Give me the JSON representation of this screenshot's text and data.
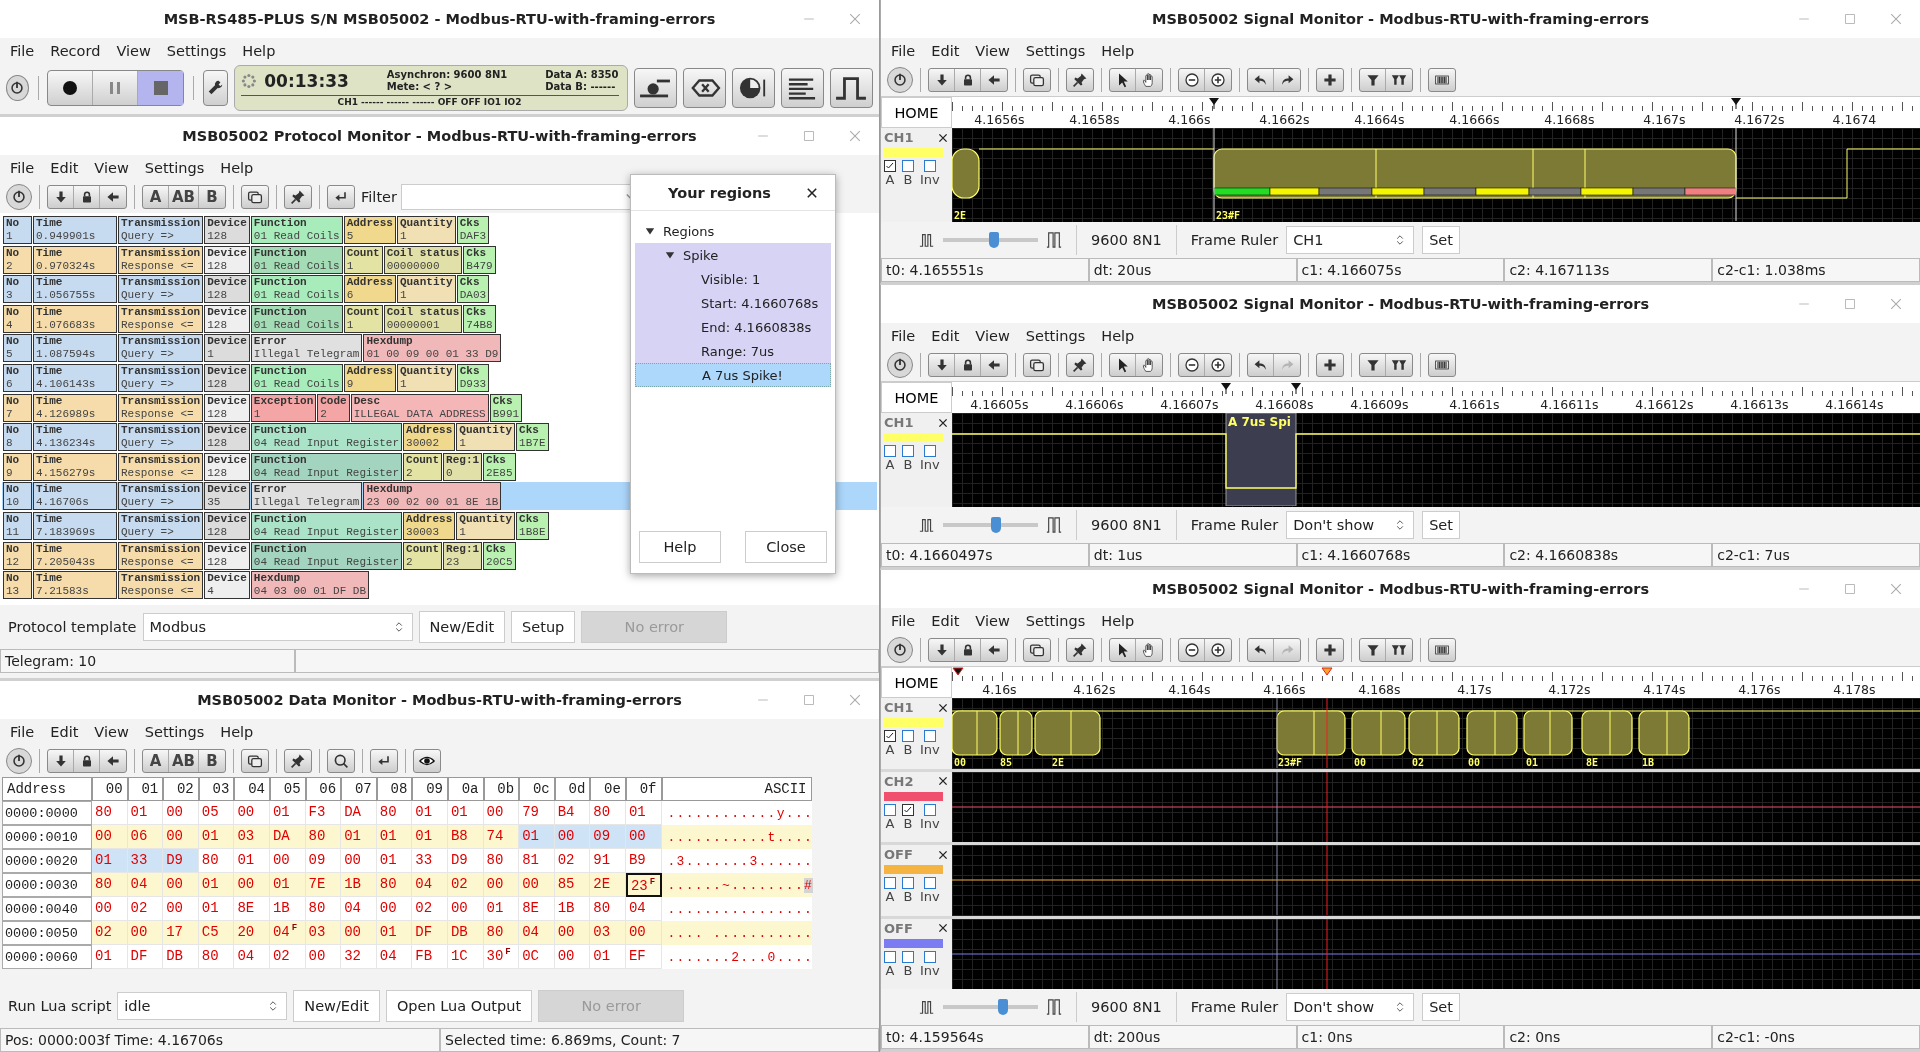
{
  "main_window": {
    "title": "MSB-RS485-PLUS S/N MSB05002 - Modbus-RTU-with-framing-errors",
    "menu": [
      "File",
      "Record",
      "View",
      "Settings",
      "Help"
    ],
    "transport": [
      {
        "kind": "record",
        "selected": false
      },
      {
        "kind": "pause",
        "selected": false
      },
      {
        "kind": "stop",
        "selected": true
      }
    ],
    "status_panel": {
      "elapsed": "00:13:33",
      "mode": "Asynchron: 9600 8N1",
      "mete": "Mete: < ? >",
      "data_a": "Data A: 8350",
      "data_b": "Data B: ------",
      "channels": "CH1 ------ ------ ------ OFF OFF IO1 IO2"
    }
  },
  "protocol_monitor": {
    "title": "MSB05002 Protocol Monitor - Modbus-RTU-with-framing-errors",
    "menu": [
      "File",
      "Edit",
      "View",
      "Settings",
      "Help"
    ],
    "view_buttons": [
      "A",
      "AB",
      "B"
    ],
    "filter_label": "Filter",
    "rows": [
      {
        "selected": false,
        "fields": [
          {
            "label": "No",
            "value": "1",
            "color": "#c6daf0"
          },
          {
            "label": "Time",
            "value": "0.949901s",
            "color": "#c6daf0"
          },
          {
            "label": "Transmission",
            "value": "Query =>",
            "color": "#c6daf0"
          },
          {
            "label": "Device",
            "value": "128",
            "color": "#dcdcdc"
          },
          {
            "label": "Function",
            "value": "01 Read Coils",
            "color": "#a9ecbc"
          },
          {
            "label": "Address",
            "value": "5",
            "color": "#f0d98c"
          },
          {
            "label": "Quantity",
            "value": "1",
            "color": "#f0e0b4"
          },
          {
            "label": "Cks",
            "value": "DAF3",
            "color": "#b9f2b0"
          }
        ]
      },
      {
        "selected": false,
        "fields": [
          {
            "label": "No",
            "value": "2",
            "color": "#f5dcaa"
          },
          {
            "label": "Time",
            "value": "0.970324s",
            "color": "#f5dcaa"
          },
          {
            "label": "Transmission",
            "value": "Response <=",
            "color": "#f5dcaa"
          },
          {
            "label": "Device",
            "value": "128",
            "color": "#efefef"
          },
          {
            "label": "Function",
            "value": "01 Read Coils",
            "color": "#a3dcb5"
          },
          {
            "label": "Count",
            "value": "1",
            "color": "#e3e3a3"
          },
          {
            "label": "Coil status",
            "value": "00000000",
            "color": "#e1e0a8"
          },
          {
            "label": "Cks",
            "value": "B479",
            "color": "#b9f2b0"
          }
        ]
      },
      {
        "selected": false,
        "fields": [
          {
            "label": "No",
            "value": "3",
            "color": "#c6daf0"
          },
          {
            "label": "Time",
            "value": "1.056755s",
            "color": "#c6daf0"
          },
          {
            "label": "Transmission",
            "value": "Query =>",
            "color": "#c6daf0"
          },
          {
            "label": "Device",
            "value": "128",
            "color": "#dcdcdc"
          },
          {
            "label": "Function",
            "value": "01 Read Coils",
            "color": "#a9ecbc"
          },
          {
            "label": "Address",
            "value": "6",
            "color": "#f0d98c"
          },
          {
            "label": "Quantity",
            "value": "1",
            "color": "#f0e0b4"
          },
          {
            "label": "Cks",
            "value": "DA03",
            "color": "#b9f2b0"
          }
        ]
      },
      {
        "selected": false,
        "fields": [
          {
            "label": "No",
            "value": "4",
            "color": "#f5dcaa"
          },
          {
            "label": "Time",
            "value": "1.076683s",
            "color": "#f5dcaa"
          },
          {
            "label": "Transmission",
            "value": "Response <=",
            "color": "#f5dcaa"
          },
          {
            "label": "Device",
            "value": "128",
            "color": "#efefef"
          },
          {
            "label": "Function",
            "value": "01 Read Coils",
            "color": "#a3dcb5"
          },
          {
            "label": "Count",
            "value": "1",
            "color": "#e3e3a3"
          },
          {
            "label": "Coil status",
            "value": "00000001",
            "color": "#e1e0a8"
          },
          {
            "label": "Cks",
            "value": "74B8",
            "color": "#b9f2b0"
          }
        ]
      },
      {
        "selected": false,
        "fields": [
          {
            "label": "No",
            "value": "5",
            "color": "#c6daf0"
          },
          {
            "label": "Time",
            "value": "1.087594s",
            "color": "#c6daf0"
          },
          {
            "label": "Transmission",
            "value": "Query =>",
            "color": "#c6daf0"
          },
          {
            "label": "Device",
            "value": "1",
            "color": "#dcdcdc"
          },
          {
            "label": "Error",
            "value": "Illegal Telegram",
            "color": "#e0e0e0"
          },
          {
            "label": "Hexdump",
            "value": "01 00 09 00 01 33 D9",
            "color": "#f0b8b8"
          }
        ]
      },
      {
        "selected": false,
        "fields": [
          {
            "label": "No",
            "value": "6",
            "color": "#c6daf0"
          },
          {
            "label": "Time",
            "value": "4.106143s",
            "color": "#c6daf0"
          },
          {
            "label": "Transmission",
            "value": "Query =>",
            "color": "#c6daf0"
          },
          {
            "label": "Device",
            "value": "128",
            "color": "#dcdcdc"
          },
          {
            "label": "Function",
            "value": "01 Read Coils",
            "color": "#a9ecbc"
          },
          {
            "label": "Address",
            "value": "9",
            "color": "#f0d98c"
          },
          {
            "label": "Quantity",
            "value": "1",
            "color": "#f0e0b4"
          },
          {
            "label": "Cks",
            "value": "D933",
            "color": "#b9f2b0"
          }
        ]
      },
      {
        "selected": false,
        "fields": [
          {
            "label": "No",
            "value": "7",
            "color": "#f5dcaa"
          },
          {
            "label": "Time",
            "value": "4.126989s",
            "color": "#f5dcaa"
          },
          {
            "label": "Transmission",
            "value": "Response <=",
            "color": "#f5dcaa"
          },
          {
            "label": "Device",
            "value": "128",
            "color": "#efefef"
          },
          {
            "label": "Exception",
            "value": "1",
            "color": "#f4a6a6"
          },
          {
            "label": "Code",
            "value": "2",
            "color": "#f4a6a6"
          },
          {
            "label": "Desc",
            "value": "ILLEGAL DATA ADDRESS",
            "color": "#f4b6b6"
          },
          {
            "label": "Cks",
            "value": "B991",
            "color": "#b9f2b0"
          }
        ]
      },
      {
        "selected": false,
        "fields": [
          {
            "label": "No",
            "value": "8",
            "color": "#c6daf0"
          },
          {
            "label": "Time",
            "value": "4.136234s",
            "color": "#c6daf0"
          },
          {
            "label": "Transmission",
            "value": "Query =>",
            "color": "#c6daf0"
          },
          {
            "label": "Device",
            "value": "128",
            "color": "#dcdcdc"
          },
          {
            "label": "Function",
            "value": "04 Read Input Register",
            "color": "#abe3c8"
          },
          {
            "label": "Address",
            "value": "30002",
            "color": "#f0d98c"
          },
          {
            "label": "Quantity",
            "value": "1",
            "color": "#f0e0b4"
          },
          {
            "label": "Cks",
            "value": "1B7E",
            "color": "#b9f2b0"
          }
        ]
      },
      {
        "selected": false,
        "fields": [
          {
            "label": "No",
            "value": "9",
            "color": "#f5dcaa"
          },
          {
            "label": "Time",
            "value": "4.156279s",
            "color": "#f5dcaa"
          },
          {
            "label": "Transmission",
            "value": "Response <=",
            "color": "#f5dcaa"
          },
          {
            "label": "Device",
            "value": "128",
            "color": "#efefef"
          },
          {
            "label": "Function",
            "value": "04 Read Input Register",
            "color": "#a3d4bf"
          },
          {
            "label": "Count",
            "value": "2",
            "color": "#e3e3a3"
          },
          {
            "label": "Reg:1",
            "value": "0",
            "color": "#e1e0a8"
          },
          {
            "label": "Cks",
            "value": "2E85",
            "color": "#b9f2b0"
          }
        ]
      },
      {
        "selected": true,
        "fields": [
          {
            "label": "No",
            "value": "10",
            "color": "#c6daf0"
          },
          {
            "label": "Time",
            "value": "4.16706s",
            "color": "#c6daf0"
          },
          {
            "label": "Transmission",
            "value": "Query =>",
            "color": "#c6daf0"
          },
          {
            "label": "Device",
            "value": "35",
            "color": "#dcdcdc"
          },
          {
            "label": "Error",
            "value": "Illegal Telegram",
            "color": "#e0e0e0"
          },
          {
            "label": "Hexdump",
            "value": "23 00 02 00 01 8E 1B",
            "color": "#f0b8b8"
          }
        ]
      },
      {
        "selected": false,
        "fields": [
          {
            "label": "No",
            "value": "11",
            "color": "#c6daf0"
          },
          {
            "label": "Time",
            "value": "7.183969s",
            "color": "#c6daf0"
          },
          {
            "label": "Transmission",
            "value": "Query =>",
            "color": "#c6daf0"
          },
          {
            "label": "Device",
            "value": "128",
            "color": "#dcdcdc"
          },
          {
            "label": "Function",
            "value": "04 Read Input Register",
            "color": "#abe3c8"
          },
          {
            "label": "Address",
            "value": "30003",
            "color": "#f0d98c"
          },
          {
            "label": "Quantity",
            "value": "1",
            "color": "#f0e0b4"
          },
          {
            "label": "Cks",
            "value": "1B8E",
            "color": "#b9f2b0"
          }
        ]
      },
      {
        "selected": false,
        "fields": [
          {
            "label": "No",
            "value": "12",
            "color": "#f5dcaa"
          },
          {
            "label": "Time",
            "value": "7.205043s",
            "color": "#f5dcaa"
          },
          {
            "label": "Transmission",
            "value": "Response <=",
            "color": "#f5dcaa"
          },
          {
            "label": "Device",
            "value": "128",
            "color": "#efefef"
          },
          {
            "label": "Function",
            "value": "04 Read Input Register",
            "color": "#a3d4bf"
          },
          {
            "label": "Count",
            "value": "2",
            "color": "#e3e3a3"
          },
          {
            "label": "Reg:1",
            "value": "23",
            "color": "#e1e0a8"
          },
          {
            "label": "Cks",
            "value": "20C5",
            "color": "#b9f2b0"
          }
        ]
      },
      {
        "selected": false,
        "fields": [
          {
            "label": "No",
            "value": "13",
            "color": "#f5dcaa"
          },
          {
            "label": "Time",
            "value": "7.21583s",
            "color": "#f5dcaa"
          },
          {
            "label": "Transmission",
            "value": "Response <=",
            "color": "#f5dcaa"
          },
          {
            "label": "Device",
            "value": "4",
            "color": "#efefef"
          },
          {
            "label": "Hexdump",
            "value": "04 03 00 01 DF DB",
            "color": "#f0b8b8"
          }
        ]
      }
    ],
    "template_label": "Protocol template",
    "template": "Modbus",
    "buttons": [
      {
        "label": "New/Edit",
        "disabled": false
      },
      {
        "label": "Setup",
        "disabled": false
      },
      {
        "label": "No error",
        "disabled": true
      }
    ],
    "status": "Telegram: 10"
  },
  "regions_dialog": {
    "title": "Your regions",
    "tree": [
      {
        "label": "Regions",
        "expanded": true,
        "selected": false,
        "children": [
          {
            "label": "Spike",
            "expanded": true,
            "selected": false,
            "color": "#d7d3f4",
            "children": [
              {
                "label": "Visible: 1",
                "selected": false
              },
              {
                "label": "Start: 4.1660768s",
                "selected": false
              },
              {
                "label": "End: 4.1660838s",
                "selected": false
              },
              {
                "label": "Range: 7us",
                "selected": false
              },
              {
                "label": "A 7us Spike!",
                "selected": true
              }
            ]
          }
        ]
      }
    ],
    "buttons": [
      "Help",
      "Close"
    ]
  },
  "data_monitor": {
    "title": "MSB05002 Data Monitor - Modbus-RTU-with-framing-errors",
    "menu": [
      "File",
      "Edit",
      "View",
      "Settings",
      "Help"
    ],
    "view_buttons": [
      "A",
      "AB",
      "B"
    ],
    "columns": [
      "Address",
      "00",
      "01",
      "02",
      "03",
      "04",
      "05",
      "06",
      "07",
      "08",
      "09",
      "0a",
      "0b",
      "0c",
      "0d",
      "0e",
      "0f",
      "ASCII"
    ],
    "rows": [
      {
        "address": "0000:0000",
        "ascii": "............y...",
        "cells": [
          {
            "value": "80",
            "selected": false,
            "focused": false
          },
          {
            "value": "01",
            "selected": false,
            "focused": false
          },
          {
            "value": "00",
            "selected": false,
            "focused": false
          },
          {
            "value": "05",
            "selected": false,
            "focused": false
          },
          {
            "value": "00",
            "selected": false,
            "focused": false
          },
          {
            "value": "01",
            "selected": false,
            "focused": false
          },
          {
            "value": "F3",
            "selected": false,
            "focused": false
          },
          {
            "value": "DA",
            "selected": false,
            "focused": false
          },
          {
            "value": "80",
            "selected": false,
            "focused": false
          },
          {
            "value": "01",
            "selected": false,
            "focused": false
          },
          {
            "value": "01",
            "selected": false,
            "focused": false
          },
          {
            "value": "00",
            "selected": false,
            "focused": false
          },
          {
            "value": "79",
            "selected": false,
            "focused": false
          },
          {
            "value": "B4",
            "selected": false,
            "focused": false
          },
          {
            "value": "80",
            "selected": false,
            "focused": false
          },
          {
            "value": "01",
            "selected": false,
            "focused": false
          }
        ]
      },
      {
        "address": "0000:0010",
        "ascii": "...........t....",
        "cells": [
          {
            "value": "00",
            "selected": false,
            "focused": false
          },
          {
            "value": "06",
            "selected": false,
            "focused": false
          },
          {
            "value": "00",
            "selected": false,
            "focused": false
          },
          {
            "value": "01",
            "selected": false,
            "focused": false
          },
          {
            "value": "03",
            "selected": false,
            "focused": false
          },
          {
            "value": "DA",
            "selected": false,
            "focused": false
          },
          {
            "value": "80",
            "selected": false,
            "focused": false
          },
          {
            "value": "01",
            "selected": false,
            "focused": false
          },
          {
            "value": "01",
            "selected": false,
            "focused": false
          },
          {
            "value": "01",
            "selected": false,
            "focused": false
          },
          {
            "value": "B8",
            "selected": false,
            "focused": false
          },
          {
            "value": "74",
            "selected": false,
            "focused": false
          },
          {
            "value": "01",
            "selected": true,
            "focused": false
          },
          {
            "value": "00",
            "selected": true,
            "focused": false
          },
          {
            "value": "09",
            "selected": true,
            "focused": false
          },
          {
            "value": "00",
            "selected": true,
            "focused": false
          }
        ]
      },
      {
        "address": "0000:0020",
        "ascii": ".3.......3......",
        "cells": [
          {
            "value": "01",
            "selected": true,
            "focused": false
          },
          {
            "value": "33",
            "selected": true,
            "focused": false
          },
          {
            "value": "D9",
            "selected": true,
            "focused": false
          },
          {
            "value": "80",
            "selected": false,
            "focused": false
          },
          {
            "value": "01",
            "selected": false,
            "focused": false
          },
          {
            "value": "00",
            "selected": false,
            "focused": false
          },
          {
            "value": "09",
            "selected": false,
            "focused": false
          },
          {
            "value": "00",
            "selected": false,
            "focused": false
          },
          {
            "value": "01",
            "selected": false,
            "focused": false
          },
          {
            "value": "33",
            "selected": false,
            "focused": false
          },
          {
            "value": "D9",
            "selected": false,
            "focused": false
          },
          {
            "value": "80",
            "selected": false,
            "focused": false
          },
          {
            "value": "81",
            "selected": false,
            "focused": false
          },
          {
            "value": "02",
            "selected": false,
            "focused": false
          },
          {
            "value": "91",
            "selected": false,
            "focused": false
          },
          {
            "value": "B9",
            "selected": false,
            "focused": false
          }
        ]
      },
      {
        "address": "0000:0030",
        "ascii": "......~........#",
        "cells": [
          {
            "value": "80",
            "selected": false,
            "focused": false
          },
          {
            "value": "04",
            "selected": false,
            "focused": false
          },
          {
            "value": "00",
            "selected": false,
            "focused": false
          },
          {
            "value": "01",
            "selected": false,
            "focused": false
          },
          {
            "value": "00",
            "selected": false,
            "focused": false
          },
          {
            "value": "01",
            "selected": false,
            "focused": false
          },
          {
            "value": "7E",
            "selected": false,
            "focused": false
          },
          {
            "value": "1B",
            "selected": false,
            "focused": false
          },
          {
            "value": "80",
            "selected": false,
            "focused": false
          },
          {
            "value": "04",
            "selected": false,
            "focused": false
          },
          {
            "value": "02",
            "selected": false,
            "focused": false
          },
          {
            "value": "00",
            "selected": false,
            "focused": false
          },
          {
            "value": "00",
            "selected": false,
            "focused": false
          },
          {
            "value": "85",
            "selected": false,
            "focused": false
          },
          {
            "value": "2E",
            "selected": false,
            "focused": false
          },
          {
            "value": "23$^{F}$",
            "selected": false,
            "focused": true
          }
        ]
      },
      {
        "address": "0000:0040",
        "ascii": "................",
        "cells": [
          {
            "value": "00",
            "selected": false,
            "focused": false
          },
          {
            "value": "02",
            "selected": false,
            "focused": false
          },
          {
            "value": "00",
            "selected": false,
            "focused": false
          },
          {
            "value": "01",
            "selected": false,
            "focused": false
          },
          {
            "value": "8E",
            "selected": false,
            "focused": false
          },
          {
            "value": "1B",
            "selected": false,
            "focused": false
          },
          {
            "value": "80",
            "selected": false,
            "focused": false
          },
          {
            "value": "04",
            "selected": false,
            "focused": false
          },
          {
            "value": "00",
            "selected": false,
            "focused": false
          },
          {
            "value": "02",
            "selected": false,
            "focused": false
          },
          {
            "value": "00",
            "selected": false,
            "focused": false
          },
          {
            "value": "01",
            "selected": false,
            "focused": false
          },
          {
            "value": "8E",
            "selected": false,
            "focused": false
          },
          {
            "value": "1B",
            "selected": false,
            "focused": false
          },
          {
            "value": "80",
            "selected": false,
            "focused": false
          },
          {
            "value": "04",
            "selected": false,
            "focused": false
          }
        ]
      },
      {
        "address": "0000:0050",
        "ascii": ".... ...........",
        "cells": [
          {
            "value": "02",
            "selected": false,
            "focused": false
          },
          {
            "value": "00",
            "selected": false,
            "focused": false
          },
          {
            "value": "17",
            "selected": false,
            "focused": false
          },
          {
            "value": "C5",
            "selected": false,
            "focused": false
          },
          {
            "value": "20",
            "selected": false,
            "focused": false
          },
          {
            "value": "04$^{F}$",
            "selected": false,
            "focused": false
          },
          {
            "value": "03",
            "selected": false,
            "focused": false
          },
          {
            "value": "00",
            "selected": false,
            "focused": false
          },
          {
            "value": "01",
            "selected": false,
            "focused": false
          },
          {
            "value": "DF",
            "selected": false,
            "focused": false
          },
          {
            "value": "DB",
            "selected": false,
            "focused": false
          },
          {
            "value": "80",
            "selected": false,
            "focused": false
          },
          {
            "value": "04",
            "selected": false,
            "focused": false
          },
          {
            "value": "00",
            "selected": false,
            "focused": false
          },
          {
            "value": "03",
            "selected": false,
            "focused": false
          },
          {
            "value": "00",
            "selected": false,
            "focused": false
          }
        ]
      },
      {
        "address": "0000:0060",
        "ascii": ".......2...0....",
        "cells": [
          {
            "value": "01",
            "selected": false,
            "focused": false
          },
          {
            "value": "DF",
            "selected": false,
            "focused": false
          },
          {
            "value": "DB",
            "selected": false,
            "focused": false
          },
          {
            "value": "80",
            "selected": false,
            "focused": false
          },
          {
            "value": "04",
            "selected": false,
            "focused": false
          },
          {
            "value": "02",
            "selected": false,
            "focused": false
          },
          {
            "value": "00",
            "selected": false,
            "focused": false
          },
          {
            "value": "32",
            "selected": false,
            "focused": false
          },
          {
            "value": "04",
            "selected": false,
            "focused": false
          },
          {
            "value": "FB",
            "selected": false,
            "focused": false
          },
          {
            "value": "1C",
            "selected": false,
            "focused": false
          },
          {
            "value": "30$^{F}$",
            "selected": false,
            "focused": false
          },
          {
            "value": "0C",
            "selected": false,
            "focused": false
          },
          {
            "value": "00",
            "selected": false,
            "focused": false
          },
          {
            "value": "01",
            "selected": false,
            "focused": false
          },
          {
            "value": "EF",
            "selected": false,
            "focused": false
          }
        ]
      }
    ],
    "script_label": "Run Lua script",
    "script": "idle",
    "buttons": [
      {
        "label": "New/Edit",
        "disabled": false
      },
      {
        "label": "Open Lua Output",
        "disabled": false
      },
      {
        "label": "No error",
        "disabled": true
      }
    ],
    "status": [
      "Pos: 0000:003f Time: 4.16706s",
      "Selected time: 6.869ms, Count: 7"
    ]
  },
  "signal_monitors": [
    {
      "title": "MSB05002 Signal Monitor - Modbus-RTU-with-framing-errors",
      "menu": [
        "File",
        "Edit",
        "View",
        "Settings",
        "Help"
      ],
      "redo_disabled": false,
      "home": "HOME",
      "kind": "detail",
      "ticks": [
        "4.1656s",
        "4.1658s",
        "4.166s",
        "4.1662s",
        "4.1664s",
        "4.1666s",
        "4.1668s",
        "4.167s",
        "4.1672s",
        "4.1674"
      ],
      "channels": [
        {
          "name": "CH1",
          "color": "#ffff66",
          "checks": [
            {
              "label": "A",
              "checked": true
            },
            {
              "label": "B",
              "checked": false
            },
            {
              "label": "Inv",
              "checked": false
            }
          ],
          "frames": [
            "2E",
            "23#F"
          ]
        }
      ],
      "slider": {
        "level": 0.54
      },
      "baud": "9600 8N1",
      "ruler_label": "Frame Ruler",
      "ruler": "CH1",
      "set": "Set",
      "status": [
        "t0: 4.165551s",
        "dt: 20us",
        "c1: 4.166075s",
        "c2: 4.167113s",
        "c2-c1: 1.038ms"
      ]
    },
    {
      "title": "MSB05002 Signal Monitor - Modbus-RTU-with-framing-errors",
      "menu": [
        "File",
        "Edit",
        "View",
        "Settings",
        "Help"
      ],
      "redo_disabled": true,
      "home": "HOME",
      "kind": "spike",
      "region_label": "A 7us Spi",
      "ticks": [
        "4.16605s",
        "4.16606s",
        "4.16607s",
        "4.16608s",
        "4.16609s",
        "4.1661s",
        "4.16611s",
        "4.16612s",
        "4.16613s",
        "4.16614s"
      ],
      "channels": [
        {
          "name": "CH1",
          "color": "#ffff66",
          "checks": [
            {
              "label": "A",
              "checked": false
            },
            {
              "label": "B",
              "checked": false
            },
            {
              "label": "Inv",
              "checked": false
            }
          ]
        }
      ],
      "slider": {
        "level": 0.56
      },
      "baud": "9600 8N1",
      "ruler_label": "Frame Ruler",
      "ruler": "Don't show",
      "set": "Set",
      "status": [
        "t0: 4.1660497s",
        "dt: 1us",
        "c1: 4.1660768s",
        "c2: 4.1660838s",
        "c2-c1: 7us"
      ]
    },
    {
      "title": "MSB05002 Signal Monitor - Modbus-RTU-with-framing-errors",
      "menu": [
        "File",
        "Edit",
        "View",
        "Settings",
        "Help"
      ],
      "redo_disabled": true,
      "home": "HOME",
      "kind": "overview",
      "ticks": [
        "4.16s",
        "4.162s",
        "4.164s",
        "4.166s",
        "4.168s",
        "4.17s",
        "4.172s",
        "4.174s",
        "4.176s",
        "4.178s"
      ],
      "channels": [
        {
          "name": "CH1",
          "color": "#ffff66",
          "checks": [
            {
              "label": "A",
              "checked": true
            },
            {
              "label": "B",
              "checked": false
            },
            {
              "label": "Inv",
              "checked": false
            }
          ],
          "frames": [
            "00",
            "85",
            "2E",
            "23#F",
            "00",
            "02",
            "00",
            "01",
            "8E",
            "1B"
          ]
        },
        {
          "name": "CH2",
          "color": "#f0506e",
          "checks": [
            {
              "label": "A",
              "checked": false
            },
            {
              "label": "B",
              "checked": true
            },
            {
              "label": "Inv",
              "checked": false
            }
          ]
        },
        {
          "name": "OFF",
          "color": "#f5b342",
          "checks": [
            {
              "label": "A",
              "checked": false
            },
            {
              "label": "B",
              "checked": false
            },
            {
              "label": "Inv",
              "checked": false
            }
          ]
        },
        {
          "name": "OFF",
          "color": "#7c7cf2",
          "checks": [
            {
              "label": "A",
              "checked": false
            },
            {
              "label": "B",
              "checked": false
            },
            {
              "label": "Inv",
              "checked": false
            }
          ]
        }
      ],
      "slider": {
        "level": 0.63
      },
      "baud": "9600 8N1",
      "ruler_label": "Frame Ruler",
      "ruler": "Don't show",
      "set": "Set",
      "status": [
        "t0: 4.159564s",
        "dt: 200us",
        "c1: 0ns",
        "c2: 0ns",
        "c2-c1: -0ns"
      ]
    }
  ]
}
